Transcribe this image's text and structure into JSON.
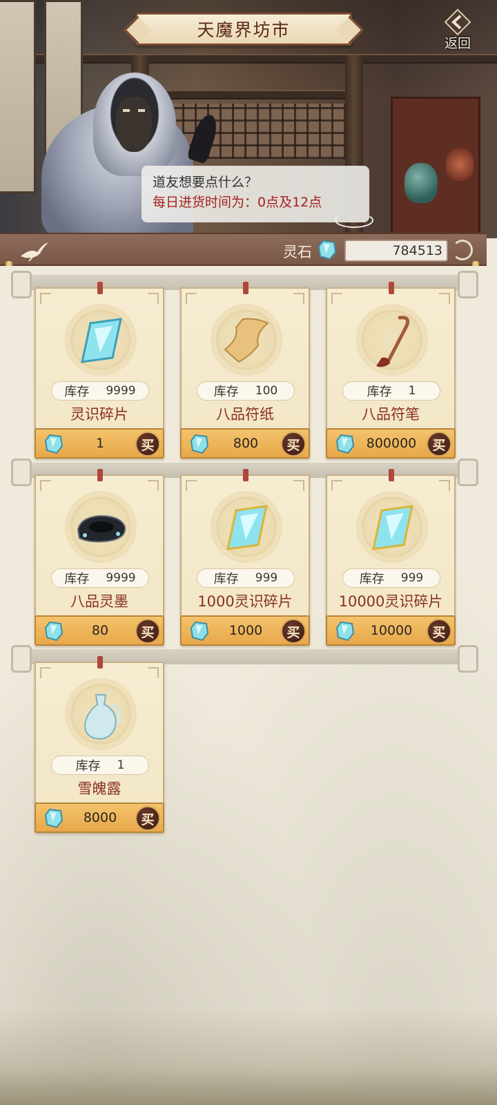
{
  "header": {
    "title": "天魔界坊市",
    "back_label": "返回"
  },
  "npc": {
    "greeting": "道友想要点什么？",
    "restock_notice": "每日进货时间为：0点及12点"
  },
  "currency": {
    "label": "灵石",
    "icon": "spirit-stone-icon",
    "amount": "784513"
  },
  "shop": {
    "stock_label": "库存",
    "buy_label": "买",
    "items": [
      {
        "name": "灵识碎片",
        "stock": "9999",
        "price": "1",
        "icon": "crystal-shard-icon"
      },
      {
        "name": "八品符纸",
        "stock": "100",
        "price": "800",
        "icon": "talisman-paper-icon"
      },
      {
        "name": "八品符笔",
        "stock": "1",
        "price": "800000",
        "icon": "talisman-brush-icon"
      },
      {
        "name": "八品灵墨",
        "stock": "9999",
        "price": "80",
        "icon": "ink-stone-icon"
      },
      {
        "name": "1000灵识碎片",
        "stock": "999",
        "price": "1000",
        "icon": "crystal-shard-icon"
      },
      {
        "name": "10000灵识碎片",
        "stock": "999",
        "price": "10000",
        "icon": "crystal-shard-icon"
      },
      {
        "name": "雪魄露",
        "stock": "1",
        "price": "8000",
        "icon": "jade-flask-icon"
      }
    ]
  },
  "colors": {
    "accent_red": "#8a2f22",
    "price_bar": "#e8a84a",
    "card_bg": "#f6ecd1"
  }
}
